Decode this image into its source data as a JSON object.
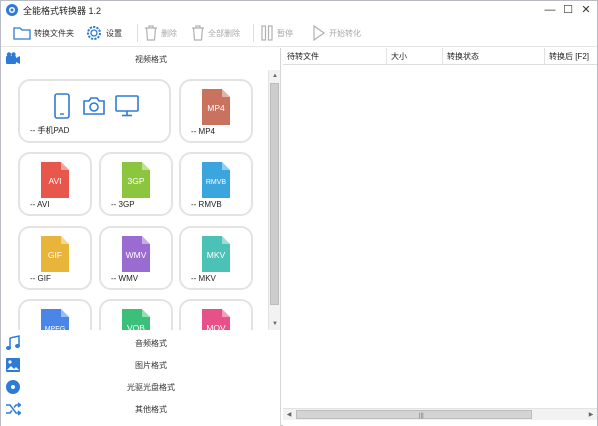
{
  "window": {
    "title": "全能格式转换器 1.2",
    "controls": {
      "minimize": "—",
      "maximize": "☐",
      "close": "✕"
    }
  },
  "toolbar": {
    "open_folder": "转换文件夹",
    "settings": "设置",
    "delete": "删除",
    "delete_all": "全部删除",
    "pause": "暂停",
    "start": "开始转化"
  },
  "categories": {
    "video": "视频格式",
    "audio": "音频格式",
    "image": "图片格式",
    "disc": "光驱光盘格式",
    "other": "其他格式"
  },
  "cards": [
    {
      "label": "-- 手机PAD",
      "icons": [
        "phone-icon",
        "camera-icon",
        "monitor-icon"
      ]
    },
    {
      "label": "-- MP4",
      "ext": "MP4",
      "color": "#c9735f"
    },
    {
      "label": "-- AVI",
      "ext": "AVI",
      "color": "#e8574b"
    },
    {
      "label": "-- 3GP",
      "ext": "3GP",
      "color": "#8cc63f"
    },
    {
      "label": "-- RMVB",
      "ext": "RMVB",
      "color": "#3aa6dd"
    },
    {
      "label": "-- GIF",
      "ext": "GIF",
      "color": "#e9b43a"
    },
    {
      "label": "-- WMV",
      "ext": "WMV",
      "color": "#9a6cd1"
    },
    {
      "label": "-- MKV",
      "ext": "MKV",
      "color": "#4cc2b7"
    },
    {
      "label": "",
      "ext": "MPEG",
      "color": "#4a86e8"
    },
    {
      "label": "",
      "ext": "VOB",
      "color": "#3cbf7a"
    },
    {
      "label": "",
      "ext": "MOV",
      "color": "#e8508a"
    }
  ],
  "table": {
    "columns": [
      "待转文件",
      "大小",
      "转换状态",
      "转换后 [F2]"
    ]
  },
  "colors": {
    "accent": "#2e7bd6",
    "disabled": "#b0b0b0"
  }
}
